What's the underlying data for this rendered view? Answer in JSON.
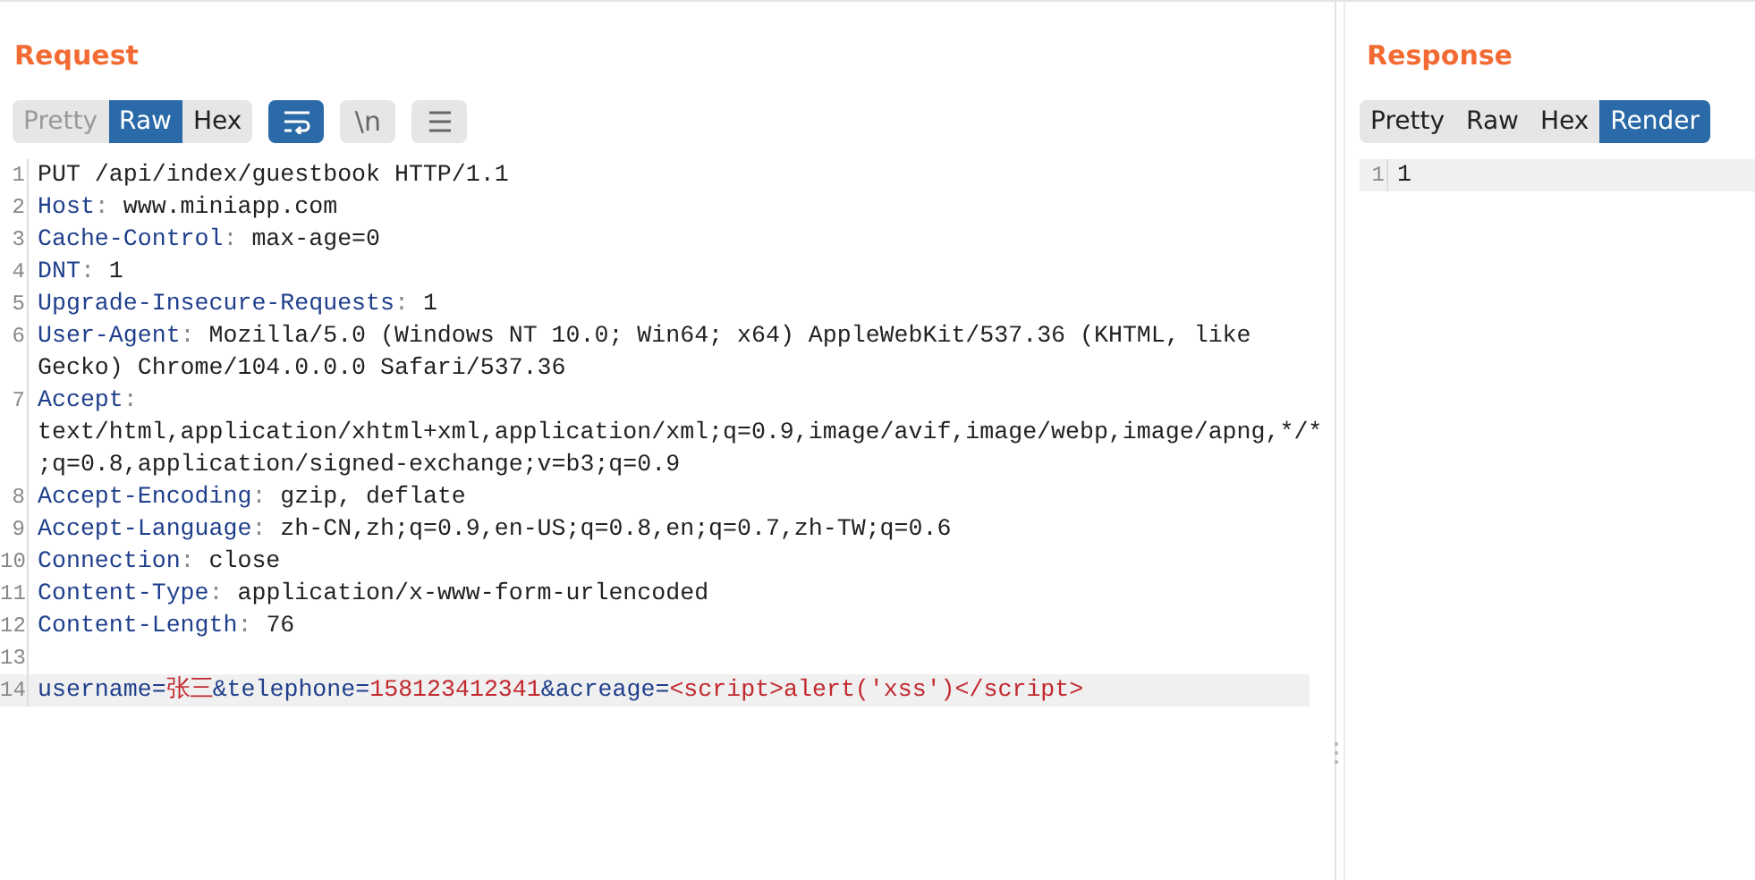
{
  "request": {
    "title": "Request",
    "tabs": [
      {
        "label": "Pretty",
        "selected": false
      },
      {
        "label": "Raw",
        "selected": true
      },
      {
        "label": "Hex",
        "selected": false
      }
    ],
    "tools": [
      {
        "kind": "wrap",
        "selected": true
      },
      {
        "kind": "text",
        "label": "\\n",
        "selected": false
      },
      {
        "kind": "menu",
        "selected": false
      }
    ],
    "lines": [
      {
        "number": "1",
        "highlighted": false,
        "rows": [
          [
            {
              "kind": "plain",
              "text": "PUT /api/index/guestbook HTTP/1.1"
            }
          ]
        ]
      },
      {
        "number": "2",
        "highlighted": false,
        "rows": [
          [
            {
              "kind": "key",
              "text": "Host"
            },
            {
              "kind": "punct",
              "text": ": "
            },
            {
              "kind": "plain",
              "text": "www.miniapp.com"
            }
          ]
        ]
      },
      {
        "number": "3",
        "highlighted": false,
        "rows": [
          [
            {
              "kind": "key",
              "text": "Cache-Control"
            },
            {
              "kind": "punct",
              "text": ": "
            },
            {
              "kind": "plain",
              "text": "max-age=0"
            }
          ]
        ]
      },
      {
        "number": "4",
        "highlighted": false,
        "rows": [
          [
            {
              "kind": "key",
              "text": "DNT"
            },
            {
              "kind": "punct",
              "text": ": "
            },
            {
              "kind": "plain",
              "text": "1"
            }
          ]
        ]
      },
      {
        "number": "5",
        "highlighted": false,
        "rows": [
          [
            {
              "kind": "key",
              "text": "Upgrade-Insecure-Requests"
            },
            {
              "kind": "punct",
              "text": ": "
            },
            {
              "kind": "plain",
              "text": "1"
            }
          ]
        ]
      },
      {
        "number": "6",
        "highlighted": false,
        "rows": [
          [
            {
              "kind": "key",
              "text": "User-Agent"
            },
            {
              "kind": "punct",
              "text": ": "
            },
            {
              "kind": "plain",
              "text": "Mozilla/5.0 (Windows NT 10.0; Win64; x64) AppleWebKit/537.36 (KHTML, like"
            }
          ],
          [
            {
              "kind": "plain",
              "text": "Gecko) Chrome/104.0.0.0 Safari/537.36"
            }
          ]
        ]
      },
      {
        "number": "7",
        "highlighted": false,
        "rows": [
          [
            {
              "kind": "key",
              "text": "Accept"
            },
            {
              "kind": "punct",
              "text": ":"
            }
          ],
          [
            {
              "kind": "plain",
              "text": "text/html,application/xhtml+xml,application/xml;q=0.9,image/avif,image/webp,image/apng,*/*"
            }
          ],
          [
            {
              "kind": "plain",
              "text": ";q=0.8,application/signed-exchange;v=b3;q=0.9"
            }
          ]
        ]
      },
      {
        "number": "8",
        "highlighted": false,
        "rows": [
          [
            {
              "kind": "key",
              "text": "Accept-Encoding"
            },
            {
              "kind": "punct",
              "text": ": "
            },
            {
              "kind": "plain",
              "text": "gzip, deflate"
            }
          ]
        ]
      },
      {
        "number": "9",
        "highlighted": false,
        "rows": [
          [
            {
              "kind": "key",
              "text": "Accept-Language"
            },
            {
              "kind": "punct",
              "text": ": "
            },
            {
              "kind": "plain",
              "text": "zh-CN,zh;q=0.9,en-US;q=0.8,en;q=0.7,zh-TW;q=0.6"
            }
          ]
        ]
      },
      {
        "number": "10",
        "highlighted": false,
        "rows": [
          [
            {
              "kind": "key",
              "text": "Connection"
            },
            {
              "kind": "punct",
              "text": ": "
            },
            {
              "kind": "plain",
              "text": "close"
            }
          ]
        ]
      },
      {
        "number": "11",
        "highlighted": false,
        "rows": [
          [
            {
              "kind": "key",
              "text": "Content-Type"
            },
            {
              "kind": "punct",
              "text": ": "
            },
            {
              "kind": "plain",
              "text": "application/x-www-form-urlencoded"
            }
          ]
        ]
      },
      {
        "number": "12",
        "highlighted": false,
        "rows": [
          [
            {
              "kind": "key",
              "text": "Content-Length"
            },
            {
              "kind": "punct",
              "text": ": "
            },
            {
              "kind": "plain",
              "text": "76"
            }
          ]
        ]
      },
      {
        "number": "13",
        "highlighted": false,
        "rows": [
          []
        ]
      },
      {
        "number": "14",
        "highlighted": true,
        "rows": [
          [
            {
              "kind": "key",
              "text": "username="
            },
            {
              "kind": "value",
              "text": "张三"
            },
            {
              "kind": "key",
              "text": "&telephone="
            },
            {
              "kind": "value",
              "text": "158123412341"
            },
            {
              "kind": "key",
              "text": "&acreage="
            },
            {
              "kind": "value",
              "text": "<script>alert('xss')</script>"
            }
          ]
        ]
      }
    ]
  },
  "response": {
    "title": "Response",
    "tabs": [
      {
        "label": "Pretty",
        "selected": false
      },
      {
        "label": "Raw",
        "selected": false
      },
      {
        "label": "Hex",
        "selected": false
      },
      {
        "label": "Render",
        "selected": true
      }
    ],
    "lines": [
      {
        "number": "1",
        "highlighted": true,
        "rows": [
          [
            {
              "kind": "plain",
              "text": "1"
            }
          ]
        ]
      }
    ]
  }
}
